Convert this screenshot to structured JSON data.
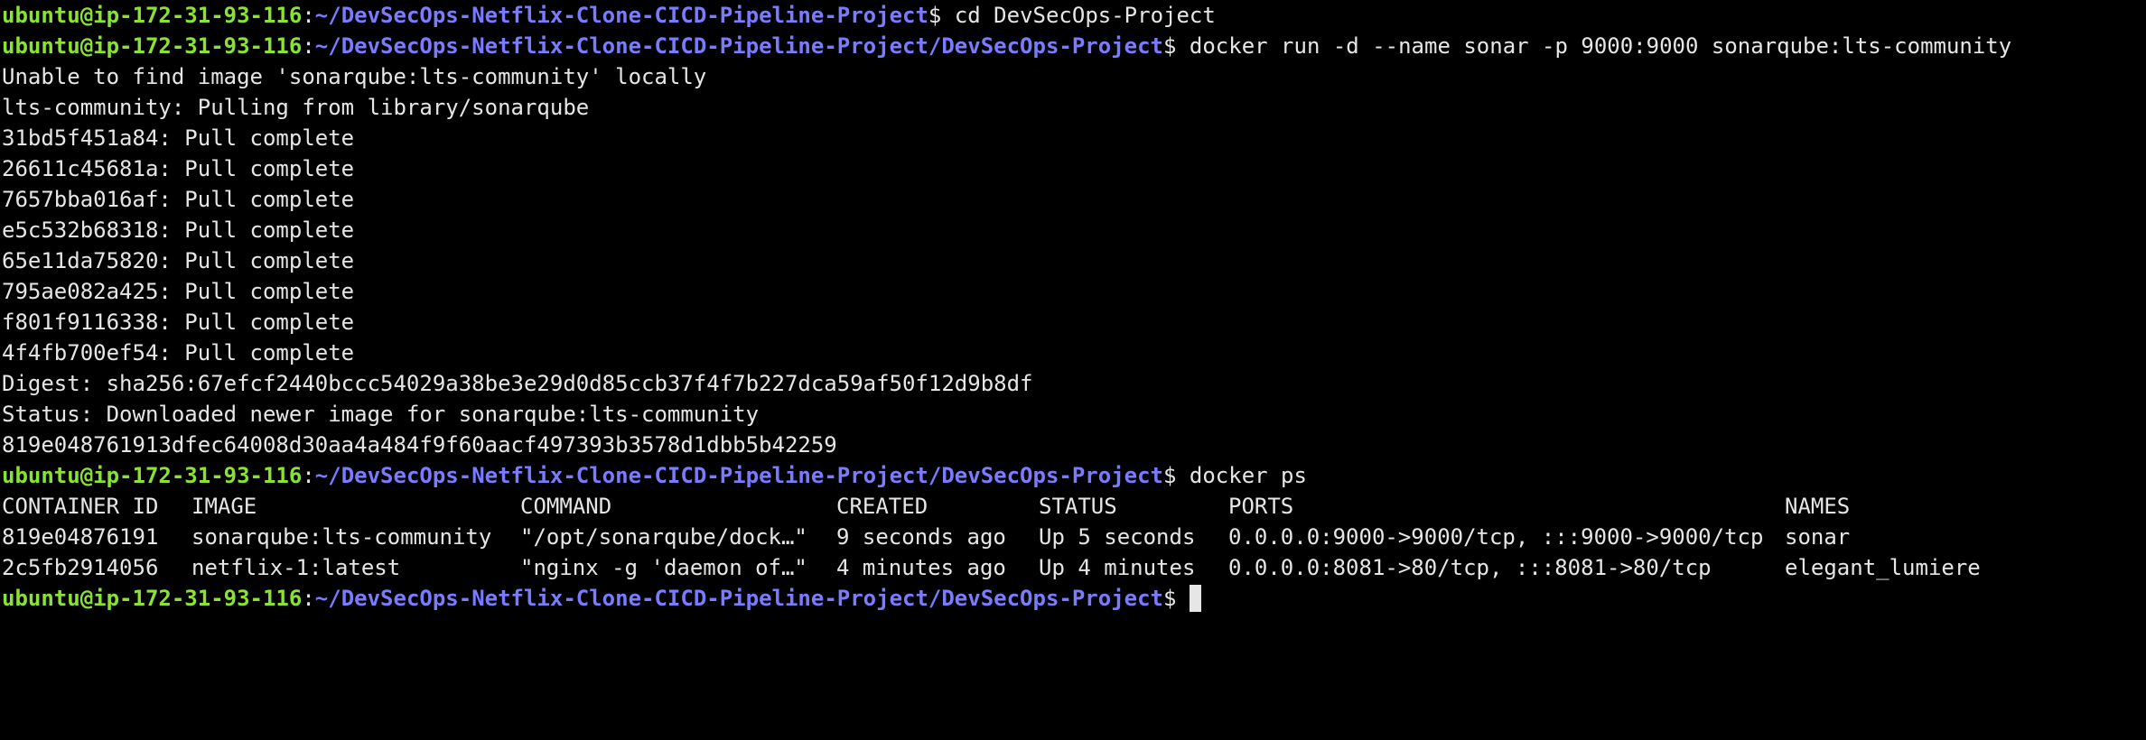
{
  "prompt": {
    "user_host": "ubuntu@ip-172-31-93-116",
    "separator": ":",
    "path1": "~/DevSecOps-Netflix-Clone-CICD-Pipeline-Project",
    "path2": "~/DevSecOps-Netflix-Clone-CICD-Pipeline-Project/DevSecOps-Project",
    "symbol": "$ "
  },
  "commands": {
    "cd": "cd DevSecOps-Project",
    "run": "docker run -d --name sonar -p 9000:9000 sonarqube:lts-community",
    "ps": "docker ps"
  },
  "output": [
    "Unable to find image 'sonarqube:lts-community' locally",
    "lts-community: Pulling from library/sonarqube",
    "31bd5f451a84: Pull complete",
    "26611c45681a: Pull complete",
    "7657bba016af: Pull complete",
    "e5c532b68318: Pull complete",
    "65e11da75820: Pull complete",
    "795ae082a425: Pull complete",
    "f801f9116338: Pull complete",
    "4f4fb700ef54: Pull complete",
    "Digest: sha256:67efcf2440bccc54029a38be3e29d0d85ccb37f4f7b227dca59af50f12d9b8df",
    "Status: Downloaded newer image for sonarqube:lts-community",
    "819e048761913dfec64008d30aa4a484f9f60aacf497393b3578d1dbb5b42259"
  ],
  "ps_table": {
    "headers": [
      "CONTAINER ID",
      "IMAGE",
      "COMMAND",
      "CREATED",
      "STATUS",
      "PORTS",
      "NAMES"
    ],
    "rows": [
      [
        "819e04876191",
        "sonarqube:lts-community",
        "\"/opt/sonarqube/dock…\"",
        "9 seconds ago",
        "Up 5 seconds",
        "0.0.0.0:9000->9000/tcp, :::9000->9000/tcp",
        "sonar"
      ],
      [
        "2c5fb2914056",
        "netflix-1:latest",
        "\"nginx -g 'daemon of…\"",
        "4 minutes ago",
        "Up 4 minutes",
        "0.0.0.0:8081->80/tcp, :::8081->80/tcp",
        "elegant_lumiere"
      ]
    ]
  },
  "colors": {
    "background": "#000000",
    "user": "#8ae234",
    "path": "#7b7bff",
    "text": "#e6e6e6"
  }
}
